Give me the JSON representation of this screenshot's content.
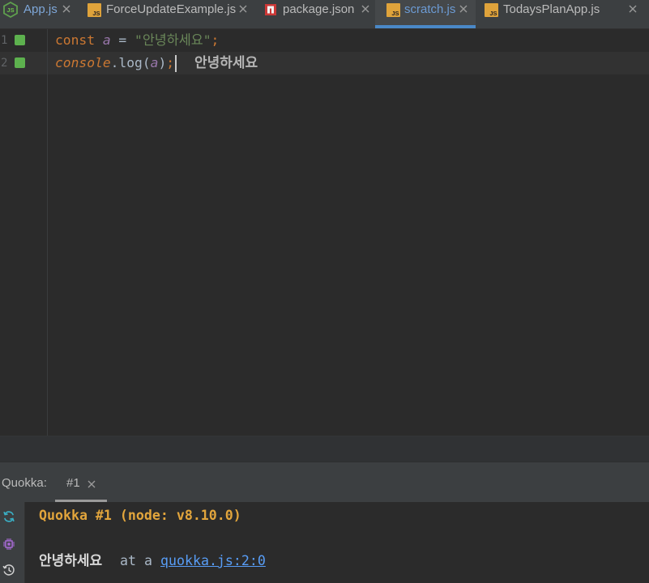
{
  "editor_tabs": [
    {
      "label": "App.js",
      "icon": "nodejs-icon",
      "active": false
    },
    {
      "label": "ForceUpdateExample.js",
      "icon": "js-file-icon",
      "active": false
    },
    {
      "label": "package.json",
      "icon": "npm-package-icon",
      "active": false
    },
    {
      "label": "scratch.js",
      "icon": "js-file-icon",
      "active": true
    },
    {
      "label": "TodaysPlanApp.js",
      "icon": "js-file-icon",
      "active": false
    }
  ],
  "icon_text": {
    "js": "JS"
  },
  "editor": {
    "lines": [
      {
        "number": "1",
        "keyword": "const",
        "variable": "a",
        "operator": "=",
        "string": "\"안녕하세요\"",
        "terminator": ";",
        "covered": true
      },
      {
        "number": "2",
        "object": "console",
        "call": ".log(",
        "argument": "a",
        "close_paren": ")",
        "terminator": ";",
        "covered": true,
        "current": true
      }
    ],
    "inline_result": "안녕하세요"
  },
  "quokka": {
    "panel_label": "Quokka:",
    "session_tab": "#1",
    "session_header": "Quokka #1 (node: v8.10.0)",
    "log_value": "안녕하세요",
    "log_prefix": "at a",
    "log_link": "quokka.js:2:0",
    "toolbar_icons": [
      "sync-icon",
      "cpu-chip-icon",
      "history-icon"
    ]
  },
  "colors": {
    "keyword": "#cc7832",
    "identifier": "#9876aa",
    "string": "#6a8759",
    "plain_code": "#a9b7c6",
    "active_tab_underline": "#4a88c7",
    "highlighted_tab_label": "#7ea7d8",
    "coverage_marker": "#5db14e",
    "quokka_header": "#e2a53c",
    "link": "#589df6"
  }
}
